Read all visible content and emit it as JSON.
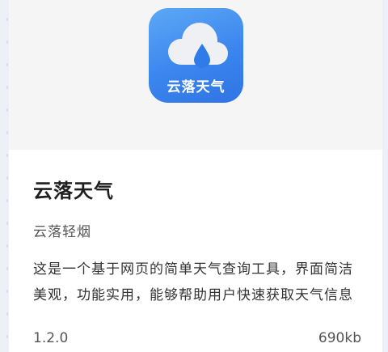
{
  "app": {
    "icon_name": "cloud-raindrop-icon",
    "icon_caption": "云落天气",
    "title": "云落天气",
    "author": "云落轻烟",
    "description": "这是一个基于网页的简单天气查询工具，界面简洁美观，功能实用，能够帮助用户快速获取天气信息",
    "version": "1.2.0",
    "size": "690kb"
  },
  "colors": {
    "icon_gradient_start": "#5ea8f6",
    "icon_gradient_end": "#2f74e4",
    "cloud": "#eef0f4",
    "raindrop": "#2f7ce8"
  }
}
